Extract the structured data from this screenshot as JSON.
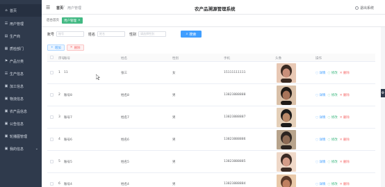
{
  "sidebar": {
    "items": [
      {
        "icon": "home-icon",
        "glyph": "⌂",
        "label": "首页"
      },
      {
        "icon": "users-icon",
        "glyph": "☰",
        "label": "用户管理"
      },
      {
        "icon": "store-icon",
        "glyph": "▤",
        "label": "生产商"
      },
      {
        "icon": "dept-icon",
        "glyph": "▦",
        "label": "质检部门"
      },
      {
        "icon": "flag-icon",
        "glyph": "⚑",
        "label": "产品分类"
      },
      {
        "icon": "info-icon",
        "glyph": "☰",
        "label": "生产信息"
      },
      {
        "icon": "process-icon",
        "glyph": "▣",
        "label": "加工信息"
      },
      {
        "icon": "logistics-icon",
        "glyph": "▣",
        "label": "物流信息"
      },
      {
        "icon": "product-icon",
        "glyph": "▣",
        "label": "农产品信息"
      },
      {
        "icon": "notice-icon",
        "glyph": "▣",
        "label": "公告信息"
      },
      {
        "icon": "carousel-icon",
        "glyph": "▣",
        "label": "轮播图管理"
      },
      {
        "icon": "mine-icon",
        "glyph": "▣",
        "label": "我的信息"
      }
    ]
  },
  "header": {
    "breadcrumb_home": "首页",
    "breadcrumb_sep": "/",
    "breadcrumb_current": "用户管理",
    "title": "农产品溯源管理系统",
    "logout": "退出系统"
  },
  "tabs": {
    "home": "后台首页",
    "active": "用户管理",
    "active_close": "×"
  },
  "search": {
    "account_label": "账号",
    "account_placeholder": "账号",
    "name_label": "姓名",
    "name_placeholder": "姓名",
    "gender_label": "性别",
    "gender_placeholder": "请选择性别",
    "button": "搜索"
  },
  "actions": {
    "add": "增加",
    "delete": "删除"
  },
  "table": {
    "headers": {
      "index": "序号",
      "account": "账号",
      "name": "姓名",
      "gender": "性别",
      "phone": "手机",
      "avatar": "头像",
      "ops": "操作"
    },
    "rows": [
      {
        "index": "1",
        "account": "11",
        "name": "张三",
        "gender": "女",
        "phone": "15111111111"
      },
      {
        "index": "2",
        "account": "账号8",
        "name": "姓名8",
        "gender": "男",
        "phone": "13823888888"
      },
      {
        "index": "3",
        "account": "账号7",
        "name": "姓名7",
        "gender": "男",
        "phone": "13823888887"
      },
      {
        "index": "4",
        "account": "账号6",
        "name": "姓名6",
        "gender": "男",
        "phone": "13823888886"
      },
      {
        "index": "5",
        "account": "账号5",
        "name": "姓名5",
        "gender": "男",
        "phone": "13823888885"
      },
      {
        "index": "6",
        "account": "账号4",
        "name": "姓名4",
        "gender": "男",
        "phone": "13823888884"
      }
    ],
    "op_detail": "详情",
    "op_edit": "修改",
    "op_delete": "删除"
  },
  "colors": {
    "sidebar_bg": "#2f3a4c",
    "accent_green": "#42b983",
    "primary_blue": "#409eff",
    "danger_red": "#f56c6c"
  }
}
